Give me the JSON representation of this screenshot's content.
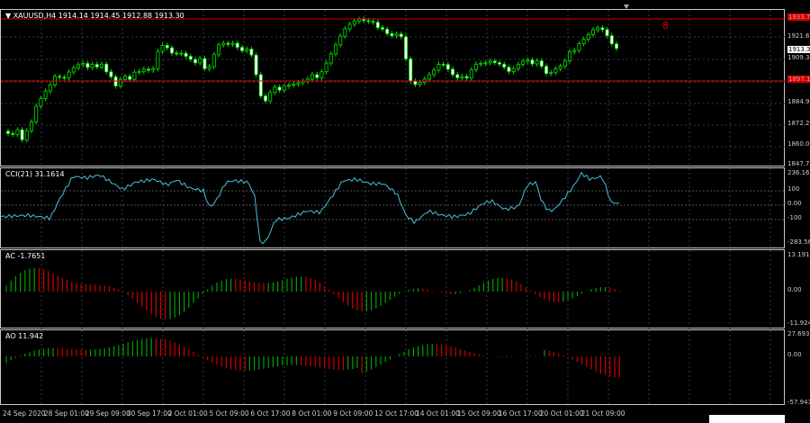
{
  "main": {
    "title": "XAUUSD,H4  1914.14 1914.45 1912.88 1913.30",
    "object_label": "8",
    "price_ticks": [
      "1933.75",
      "1921.60",
      "1909.35",
      "1897.15",
      "1884.95",
      "1872.25",
      "1860.00",
      "1847.75"
    ],
    "current_price": "1913.30",
    "hline_upper": "1933.75",
    "hline_lower": "1897.15",
    "colors": {
      "bull": "#00e000",
      "bear": "#00e000",
      "level": "#e00000",
      "grid": "#3a4a5a"
    }
  },
  "cci": {
    "label": "CCI(21) 31.1614",
    "ticks": [
      "236.165",
      "100",
      "0.00",
      "-100",
      "-283.56"
    ],
    "color": "#48c0d8"
  },
  "ac": {
    "label": "AC -1.7651",
    "ticks": [
      "13.1914",
      "0.00",
      "-11.9247"
    ],
    "colors": {
      "up": "#00a000",
      "down": "#d00000"
    }
  },
  "ao": {
    "label": "AO 11.942",
    "ticks": [
      "27.693",
      "0.00",
      "-57.943"
    ],
    "colors": {
      "up": "#00a000",
      "down": "#d00000"
    }
  },
  "time_labels": [
    "24 Sep 2020",
    "28 Sep 01:00",
    "29 Sep 09:00",
    "30 Sep 17:00",
    "2 Oct 01:00",
    "5 Oct 09:00",
    "6 Oct 17:00",
    "8 Oct 01:00",
    "9 Oct 09:00",
    "12 Oct 17:00",
    "14 Oct 01:00",
    "15 Oct 09:00",
    "16 Oct 17:00",
    "20 Oct 01:00",
    "21 Oct 09:00"
  ]
}
